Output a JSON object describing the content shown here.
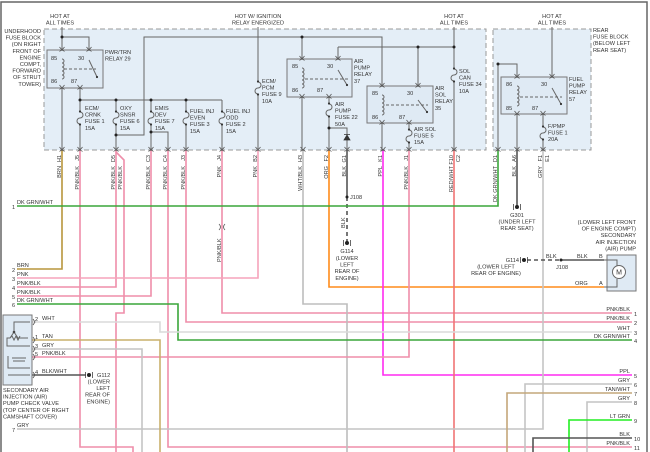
{
  "power_labels": {
    "hot_at_all_times": [
      "HOT AT",
      "ALL TIMES"
    ],
    "hot_ignition": [
      "HOT W/ IGNITION",
      "RELAY ENERGIZED"
    ]
  },
  "underhood_fuse_block": {
    "location": [
      "UNDERHOOD",
      "FUSE BLOCK",
      "(ON RIGHT",
      "FRONT OF",
      "ENGINE",
      "COMPT,",
      "FORWARD",
      "OF STRUT",
      "TOWER)"
    ]
  },
  "rear_fuse_block": {
    "location": [
      "REAR",
      "FUSE BLOCK",
      "(BELOW LEFT",
      "REAR SEAT)"
    ]
  },
  "relays": [
    {
      "name": [
        "PWR/TRN",
        "RELAY 29"
      ],
      "pins": [
        "85",
        "30",
        "86",
        "87"
      ]
    },
    {
      "name": [
        "AIR",
        "PUMP",
        "RELAY",
        "37"
      ],
      "pins": [
        "85",
        "30",
        "86",
        "87"
      ]
    },
    {
      "name": [
        "AIR",
        "SOL",
        "RELAY",
        "35"
      ],
      "pins": [
        "85",
        "30",
        "86",
        "87"
      ]
    },
    {
      "name": [
        "FUEL",
        "PUMP",
        "RELAY",
        "57"
      ],
      "pins": [
        "86",
        "30",
        "85",
        "87"
      ]
    }
  ],
  "fuses": [
    {
      "label": [
        "ECM/",
        "CRNK",
        "FUSE 1",
        "15A"
      ]
    },
    {
      "label": [
        "OXY",
        "SNSR",
        "FUSE 6",
        "15A"
      ]
    },
    {
      "label": [
        "EMIS",
        "DEV",
        "FUSE 7",
        "15A"
      ]
    },
    {
      "label": [
        "FUEL INJ",
        "EVEN",
        "FUSE 3",
        "15A"
      ]
    },
    {
      "label": [
        "FUEL INJ",
        "ODD",
        "FUSE 2",
        "15A"
      ]
    },
    {
      "label": [
        "ECM/",
        "PCM",
        "FUSE 9",
        "10A"
      ]
    },
    {
      "label": [
        "AIR",
        "PUMP",
        "FUSE 22",
        "50A"
      ]
    },
    {
      "label": [
        "SOL",
        "CAN",
        "FUSE 34",
        "10A"
      ]
    },
    {
      "label": [
        "AIR SOL",
        "FUSE 5",
        "15A"
      ]
    },
    {
      "label": [
        "F/PMP",
        "FUSE 1",
        "20A"
      ]
    }
  ],
  "pins": [
    {
      "id": "H1",
      "wire": "BRN"
    },
    {
      "id": "J5",
      "wire": "PNK/BLK"
    },
    {
      "id": "D5",
      "wire": "PNK/BLK",
      "wire2": "PNK/BLK"
    },
    {
      "id": "C3",
      "wire": "PNK/BLK"
    },
    {
      "id": "C4",
      "wire": "PNK/BLK"
    },
    {
      "id": "J3",
      "wire": "PNK/BLK"
    },
    {
      "id": "J4",
      "wire": "PNK"
    },
    {
      "id": "B2",
      "wire": "PNK"
    },
    {
      "id": "H3",
      "wire": "WHT/BLK"
    },
    {
      "id": "F2",
      "wire": "ORG"
    },
    {
      "id": "G1",
      "wire": "BLK"
    },
    {
      "id": "K1",
      "wire": "PPL"
    },
    {
      "id": "J1",
      "wire": "PNK/BLK"
    },
    {
      "id": "F10",
      "wire": "RED/WHT",
      "cavity": "C2"
    },
    {
      "id": "D1",
      "wire": "DK GRN/WHT"
    },
    {
      "id": "A6",
      "wire": "BLK"
    },
    {
      "id": "F1",
      "wire": "GRY",
      "cavity": "E1"
    }
  ],
  "inline_wire_label": "PNK/BLK",
  "splices": {
    "j108_top": "J108",
    "j108_right": "J108",
    "dashed_blk_label": "BLK"
  },
  "grounds": {
    "g114_left": {
      "id": "G114",
      "location": [
        "(LOWER",
        "LEFT",
        "REAR OF",
        "ENGINE)"
      ]
    },
    "g301": {
      "id": "G301",
      "location": [
        "(UNDER LEFT",
        "REAR SEAT)"
      ]
    },
    "g114_right": {
      "id": "G114",
      "location": [
        "(LOWER LEFT",
        "REAR OF ENGINE)"
      ]
    },
    "g112": {
      "id": "G112",
      "location": [
        "(LOWER",
        "LEFT",
        "REAR OF",
        "ENGINE)"
      ]
    }
  },
  "air_pump": {
    "name": [
      "(LOWER LEFT FRONT",
      "OF ENGINE COMPT)",
      "SECONDARY",
      "AIR INJECTION",
      "(AIR) PUMP"
    ],
    "motor_label": "M",
    "pin_b": "B",
    "pin_a": "A",
    "wire_b1": "BLK",
    "wire_b2": "BLK",
    "wire_a": "ORG"
  },
  "check_valve": {
    "name": [
      "SECONDARY AIR",
      "INJECTION (AIR)",
      "PUMP CHECK VALVE",
      "(TOP CENTER OF RIGHT",
      "CAMSHAFT COVER)"
    ],
    "pins": [
      {
        "num": "2",
        "wire": "WHT"
      },
      {
        "num": "1",
        "wire": "TAN"
      },
      {
        "num": "3",
        "wire": "GRY"
      },
      {
        "num": "5",
        "wire": "PNK/BLK"
      },
      {
        "num": "4",
        "wire": "BLK/WHT"
      }
    ]
  },
  "left_connector": [
    {
      "num": "1",
      "wire": "DK GRN/WHT"
    },
    {
      "num": "2",
      "wire": "BRN"
    },
    {
      "num": "3",
      "wire": "PNK"
    },
    {
      "num": "4",
      "wire": "PNK/BLK"
    },
    {
      "num": "5",
      "wire": "PNK/BLK"
    },
    {
      "num": "6",
      "wire": "DK GRN/WHT"
    },
    {
      "num": "7",
      "wire": "GRY"
    }
  ],
  "right_connector": [
    {
      "num": "1",
      "wire": "PNK/BLK"
    },
    {
      "num": "2",
      "wire": "PNK/BLK"
    },
    {
      "num": "3",
      "wire": "WHT"
    },
    {
      "num": "4",
      "wire": "DK GRN/WHT"
    },
    {
      "num": "5",
      "wire": "PPL"
    },
    {
      "num": "6",
      "wire": "GRY"
    },
    {
      "num": "7",
      "wire": "TAN/WHT"
    },
    {
      "num": "8",
      "wire": "GRY"
    },
    {
      "num": "9",
      "wire": "LT GRN"
    },
    {
      "num": "10",
      "wire": "BLK"
    },
    {
      "num": "11",
      "wire": "PNK/BLK"
    }
  ],
  "wire_colors": {
    "BRN": "#b8963c",
    "PNK": "#f5a3bb",
    "PNK/BLK": "#ef8eaa",
    "ORG": "#ff8c1a",
    "BLK": "#555555",
    "PPL": "#ff2bf0",
    "RED/WHT": "#f07474",
    "DK GRN/WHT": "#3aa63a",
    "GRY": "#c4c4c4",
    "WHT": "#dadada",
    "WHT/BLK": "#bdbdbd",
    "TAN": "#c9b06c",
    "TAN/WHT": "#c4a77a",
    "LT GRN": "#22ee22",
    "BLK/WHT": "#555555"
  }
}
